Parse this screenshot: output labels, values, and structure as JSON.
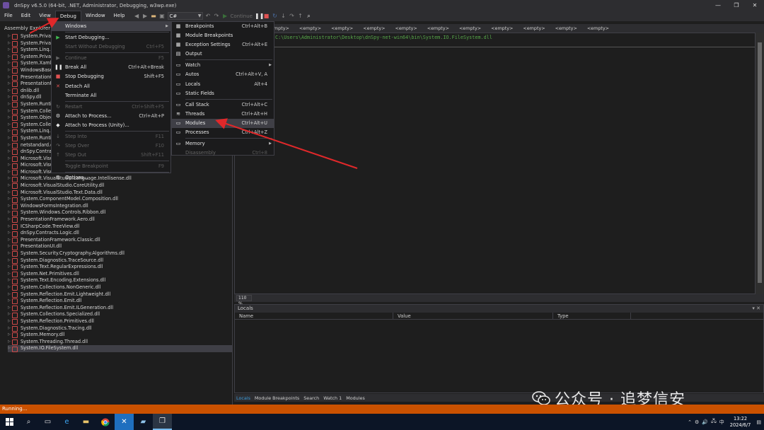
{
  "window": {
    "title": "dnSpy v6.5.0 (64-bit, .NET, Administrator, Debugging, w3wp.exe)",
    "controls": [
      "—",
      "❐",
      "✕"
    ]
  },
  "menubar": {
    "items": [
      "File",
      "Edit",
      "View",
      "Debug",
      "Window",
      "Help"
    ],
    "active": "Debug"
  },
  "toolbar": {
    "language": "C#",
    "continue_label": "Continue"
  },
  "explorer": {
    "header": "Assembly Explorer",
    "items": [
      "System.Private",
      "System.Private",
      "System.Linq.dl",
      "System.Private",
      "System.Xaml.d",
      "WindowsBase",
      "PresentationC",
      "PresentationFr",
      "dnlib.dll",
      "dnSpy.dll",
      "System.Runtim",
      "System.Collect",
      "System.Object",
      "System.Collect",
      "System.Linq.Ex",
      "System.Runtim",
      "netstandard.d",
      "dnSpy.Contract",
      "Microsoft.Visu",
      "Microsoft.Visu",
      "Microsoft.VisualStudio.Text.Ui.dll",
      "Microsoft.VisualStudio.Language.Intellisense.dll",
      "Microsoft.VisualStudio.CoreUtility.dll",
      "Microsoft.VisualStudio.Text.Data.dll",
      "System.ComponentModel.Composition.dll",
      "WindowsFormsIntegration.dll",
      "System.Windows.Controls.Ribbon.dll",
      "PresentationFramework.Aero.dll",
      "ICSharpCode.TreeView.dll",
      "dnSpy.Contracts.Logic.dll",
      "PresentationFramework.Classic.dll",
      "PresentationUI.dll",
      "System.Security.Cryptography.Algorithms.dll",
      "System.Diagnostics.TraceSource.dll",
      "System.Text.RegularExpressions.dll",
      "System.Net.Primitives.dll",
      "System.Text.Encoding.Extensions.dll",
      "System.Collections.NonGeneric.dll",
      "System.Reflection.Emit.Lightweight.dll",
      "System.Reflection.Emit.dll",
      "System.Reflection.Emit.ILGeneration.dll",
      "System.Collections.Specialized.dll",
      "System.Reflection.Primitives.dll",
      "System.Diagnostics.Tracing.dll",
      "System.Memory.dll",
      "System.Threading.Thread.dll",
      "System.IO.FileSystem.dll"
    ],
    "selected_index": 46
  },
  "tabs": [
    "stem.dll",
    "<empty>",
    "<empty>",
    "<empty>",
    "<empty>",
    "<empty>",
    "<empty>",
    "<empty>",
    "<empty>",
    "<empty>",
    "<empty>",
    "<empty>"
  ],
  "editor": {
    "code_line": "C:\\Users\\Administrator\\Desktop\\dnSpy-net-win64\\bin\\System.IO.FileSystem.dll",
    "zoom": "110 %"
  },
  "locals": {
    "title": "Locals",
    "columns": [
      "Name",
      "Value",
      "Type"
    ],
    "controls": "▾ ✕"
  },
  "bottom_tabs": [
    "Locals",
    "Module Breakpoints",
    "Search",
    "Watch 1",
    "Modules"
  ],
  "status": "Running...",
  "debug_menu": [
    {
      "label": "Windows",
      "shortcut": "",
      "icon": "",
      "submenu": true,
      "highlight": true
    },
    {
      "sep": true
    },
    {
      "label": "Start Debugging...",
      "shortcut": "",
      "icon": "▶",
      "color": "#3fb950"
    },
    {
      "label": "Start Without Debugging",
      "shortcut": "Ctrl+F5",
      "icon": "",
      "disabled": true
    },
    {
      "sep": true
    },
    {
      "label": "Continue",
      "shortcut": "F5",
      "icon": "▶",
      "disabled": true
    },
    {
      "label": "Break All",
      "shortcut": "Ctrl+Alt+Break",
      "icon": "❚❚"
    },
    {
      "label": "Stop Debugging",
      "shortcut": "Shift+F5",
      "icon": "■",
      "color": "#e05252"
    },
    {
      "label": "Detach All",
      "shortcut": "",
      "icon": "✕",
      "color": "#e05252"
    },
    {
      "label": "Terminate All",
      "shortcut": "",
      "icon": ""
    },
    {
      "sep": true
    },
    {
      "label": "Restart",
      "shortcut": "Ctrl+Shift+F5",
      "icon": "↻",
      "disabled": true
    },
    {
      "label": "Attach to Process...",
      "shortcut": "Ctrl+Alt+P",
      "icon": "⚙"
    },
    {
      "label": "Attach to Process (Unity)...",
      "shortcut": "",
      "icon": "◆"
    },
    {
      "sep": true
    },
    {
      "label": "Step Into",
      "shortcut": "F11",
      "icon": "↓",
      "disabled": true
    },
    {
      "label": "Step Over",
      "shortcut": "F10",
      "icon": "↷",
      "disabled": true
    },
    {
      "label": "Step Out",
      "shortcut": "Shift+F11",
      "icon": "↑",
      "disabled": true
    },
    {
      "sep": true
    },
    {
      "label": "Toggle Breakpoint",
      "shortcut": "F9",
      "icon": "",
      "disabled": true
    },
    {
      "sep": true
    },
    {
      "label": "Options...",
      "shortcut": "",
      "icon": "⚙"
    }
  ],
  "windows_menu": [
    {
      "label": "Breakpoints",
      "shortcut": "Ctrl+Alt+B",
      "icon": "▦"
    },
    {
      "label": "Module Breakpoints",
      "shortcut": "",
      "icon": "▦"
    },
    {
      "label": "Exception Settings",
      "shortcut": "Ctrl+Alt+E",
      "icon": "▦"
    },
    {
      "label": "Output",
      "shortcut": "",
      "icon": "▤"
    },
    {
      "sep": true
    },
    {
      "label": "Watch",
      "shortcut": "",
      "icon": "▭",
      "submenu": true
    },
    {
      "label": "Autos",
      "shortcut": "Ctrl+Alt+V, A",
      "icon": "▭"
    },
    {
      "label": "Locals",
      "shortcut": "Alt+4",
      "icon": "▭"
    },
    {
      "label": "Static Fields",
      "shortcut": "",
      "icon": "▭"
    },
    {
      "sep": true
    },
    {
      "label": "Call Stack",
      "shortcut": "Ctrl+Alt+C",
      "icon": "▭"
    },
    {
      "label": "Threads",
      "shortcut": "Ctrl+Alt+H",
      "icon": "≋"
    },
    {
      "label": "Modules",
      "shortcut": "Ctrl+Alt+U",
      "icon": "▭",
      "highlight": true
    },
    {
      "label": "Processes",
      "shortcut": "Ctrl+Alt+Z",
      "icon": "▭"
    },
    {
      "sep": true
    },
    {
      "label": "Memory",
      "shortcut": "",
      "icon": "▭",
      "submenu": true
    },
    {
      "label": "Disassembly",
      "shortcut": "Ctrl+8",
      "icon": "",
      "disabled": true
    }
  ],
  "watermark": {
    "text": "公众号 · 追梦信安"
  },
  "taskbar": {
    "tray": [
      "⌃",
      "⚙",
      "🔊",
      "🖧",
      "中"
    ],
    "time": "13:22",
    "date": "2024/6/7"
  }
}
